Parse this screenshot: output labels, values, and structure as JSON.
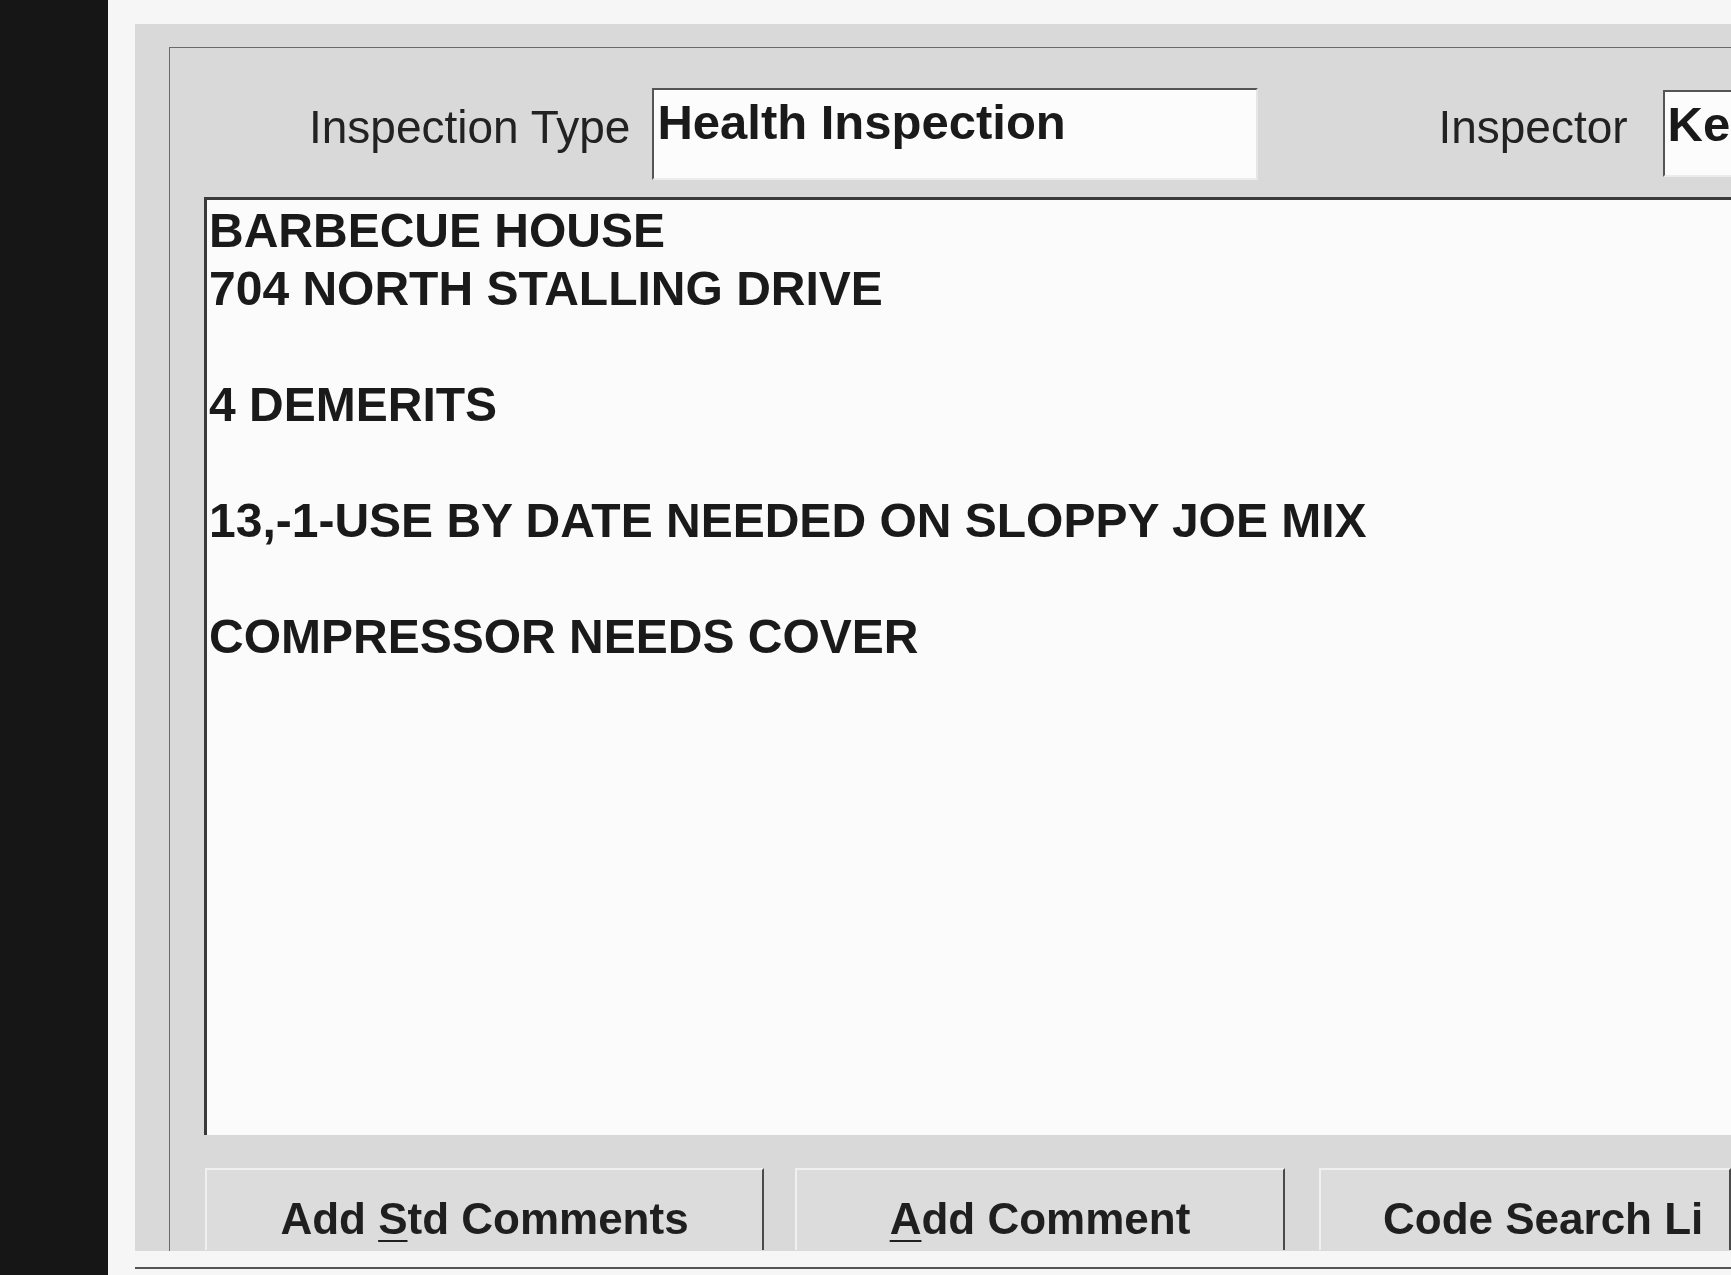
{
  "form": {
    "fields": [
      {
        "label": "Inspection Type",
        "value": "Health Inspection"
      },
      {
        "label": "Inspector",
        "value": "Ke"
      }
    ],
    "comments": {
      "paragraphs": [
        {
          "lines": [
            "BARBECUE HOUSE",
            "704 NORTH STALLING DRIVE"
          ]
        },
        {
          "lines": [
            "4 DEMERITS"
          ]
        },
        {
          "lines": [
            "13,-1-USE BY DATE NEEDED ON SLOPPY JOE MIX"
          ]
        },
        {
          "lines": [
            "COMPRESSOR NEEDS COVER"
          ]
        }
      ]
    },
    "buttons": [
      {
        "label_parts": [
          {
            "text": "Add ",
            "underline": false
          },
          {
            "text": "S",
            "underline": true
          },
          {
            "text": "td Comments",
            "underline": false
          }
        ]
      },
      {
        "label_parts": [
          {
            "text": "A",
            "underline": true
          },
          {
            "text": "dd Comment",
            "underline": false
          }
        ]
      },
      {
        "label_parts": [
          {
            "text": "Code Search Li",
            "underline": false
          }
        ]
      }
    ]
  }
}
